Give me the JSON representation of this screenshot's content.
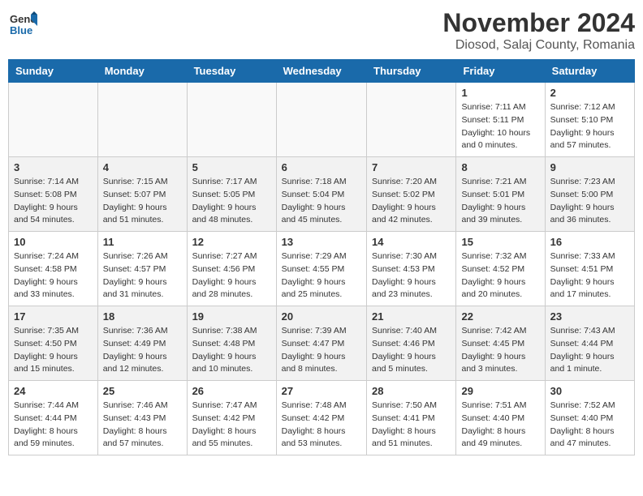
{
  "header": {
    "logo_line1": "General",
    "logo_line2": "Blue",
    "month_title": "November 2024",
    "location": "Diosod, Salaj County, Romania"
  },
  "weekdays": [
    "Sunday",
    "Monday",
    "Tuesday",
    "Wednesday",
    "Thursday",
    "Friday",
    "Saturday"
  ],
  "weeks": [
    [
      {
        "day": "",
        "info": ""
      },
      {
        "day": "",
        "info": ""
      },
      {
        "day": "",
        "info": ""
      },
      {
        "day": "",
        "info": ""
      },
      {
        "day": "",
        "info": ""
      },
      {
        "day": "1",
        "info": "Sunrise: 7:11 AM\nSunset: 5:11 PM\nDaylight: 10 hours\nand 0 minutes."
      },
      {
        "day": "2",
        "info": "Sunrise: 7:12 AM\nSunset: 5:10 PM\nDaylight: 9 hours\nand 57 minutes."
      }
    ],
    [
      {
        "day": "3",
        "info": "Sunrise: 7:14 AM\nSunset: 5:08 PM\nDaylight: 9 hours\nand 54 minutes."
      },
      {
        "day": "4",
        "info": "Sunrise: 7:15 AM\nSunset: 5:07 PM\nDaylight: 9 hours\nand 51 minutes."
      },
      {
        "day": "5",
        "info": "Sunrise: 7:17 AM\nSunset: 5:05 PM\nDaylight: 9 hours\nand 48 minutes."
      },
      {
        "day": "6",
        "info": "Sunrise: 7:18 AM\nSunset: 5:04 PM\nDaylight: 9 hours\nand 45 minutes."
      },
      {
        "day": "7",
        "info": "Sunrise: 7:20 AM\nSunset: 5:02 PM\nDaylight: 9 hours\nand 42 minutes."
      },
      {
        "day": "8",
        "info": "Sunrise: 7:21 AM\nSunset: 5:01 PM\nDaylight: 9 hours\nand 39 minutes."
      },
      {
        "day": "9",
        "info": "Sunrise: 7:23 AM\nSunset: 5:00 PM\nDaylight: 9 hours\nand 36 minutes."
      }
    ],
    [
      {
        "day": "10",
        "info": "Sunrise: 7:24 AM\nSunset: 4:58 PM\nDaylight: 9 hours\nand 33 minutes."
      },
      {
        "day": "11",
        "info": "Sunrise: 7:26 AM\nSunset: 4:57 PM\nDaylight: 9 hours\nand 31 minutes."
      },
      {
        "day": "12",
        "info": "Sunrise: 7:27 AM\nSunset: 4:56 PM\nDaylight: 9 hours\nand 28 minutes."
      },
      {
        "day": "13",
        "info": "Sunrise: 7:29 AM\nSunset: 4:55 PM\nDaylight: 9 hours\nand 25 minutes."
      },
      {
        "day": "14",
        "info": "Sunrise: 7:30 AM\nSunset: 4:53 PM\nDaylight: 9 hours\nand 23 minutes."
      },
      {
        "day": "15",
        "info": "Sunrise: 7:32 AM\nSunset: 4:52 PM\nDaylight: 9 hours\nand 20 minutes."
      },
      {
        "day": "16",
        "info": "Sunrise: 7:33 AM\nSunset: 4:51 PM\nDaylight: 9 hours\nand 17 minutes."
      }
    ],
    [
      {
        "day": "17",
        "info": "Sunrise: 7:35 AM\nSunset: 4:50 PM\nDaylight: 9 hours\nand 15 minutes."
      },
      {
        "day": "18",
        "info": "Sunrise: 7:36 AM\nSunset: 4:49 PM\nDaylight: 9 hours\nand 12 minutes."
      },
      {
        "day": "19",
        "info": "Sunrise: 7:38 AM\nSunset: 4:48 PM\nDaylight: 9 hours\nand 10 minutes."
      },
      {
        "day": "20",
        "info": "Sunrise: 7:39 AM\nSunset: 4:47 PM\nDaylight: 9 hours\nand 8 minutes."
      },
      {
        "day": "21",
        "info": "Sunrise: 7:40 AM\nSunset: 4:46 PM\nDaylight: 9 hours\nand 5 minutes."
      },
      {
        "day": "22",
        "info": "Sunrise: 7:42 AM\nSunset: 4:45 PM\nDaylight: 9 hours\nand 3 minutes."
      },
      {
        "day": "23",
        "info": "Sunrise: 7:43 AM\nSunset: 4:44 PM\nDaylight: 9 hours\nand 1 minute."
      }
    ],
    [
      {
        "day": "24",
        "info": "Sunrise: 7:44 AM\nSunset: 4:44 PM\nDaylight: 8 hours\nand 59 minutes."
      },
      {
        "day": "25",
        "info": "Sunrise: 7:46 AM\nSunset: 4:43 PM\nDaylight: 8 hours\nand 57 minutes."
      },
      {
        "day": "26",
        "info": "Sunrise: 7:47 AM\nSunset: 4:42 PM\nDaylight: 8 hours\nand 55 minutes."
      },
      {
        "day": "27",
        "info": "Sunrise: 7:48 AM\nSunset: 4:42 PM\nDaylight: 8 hours\nand 53 minutes."
      },
      {
        "day": "28",
        "info": "Sunrise: 7:50 AM\nSunset: 4:41 PM\nDaylight: 8 hours\nand 51 minutes."
      },
      {
        "day": "29",
        "info": "Sunrise: 7:51 AM\nSunset: 4:40 PM\nDaylight: 8 hours\nand 49 minutes."
      },
      {
        "day": "30",
        "info": "Sunrise: 7:52 AM\nSunset: 4:40 PM\nDaylight: 8 hours\nand 47 minutes."
      }
    ]
  ]
}
